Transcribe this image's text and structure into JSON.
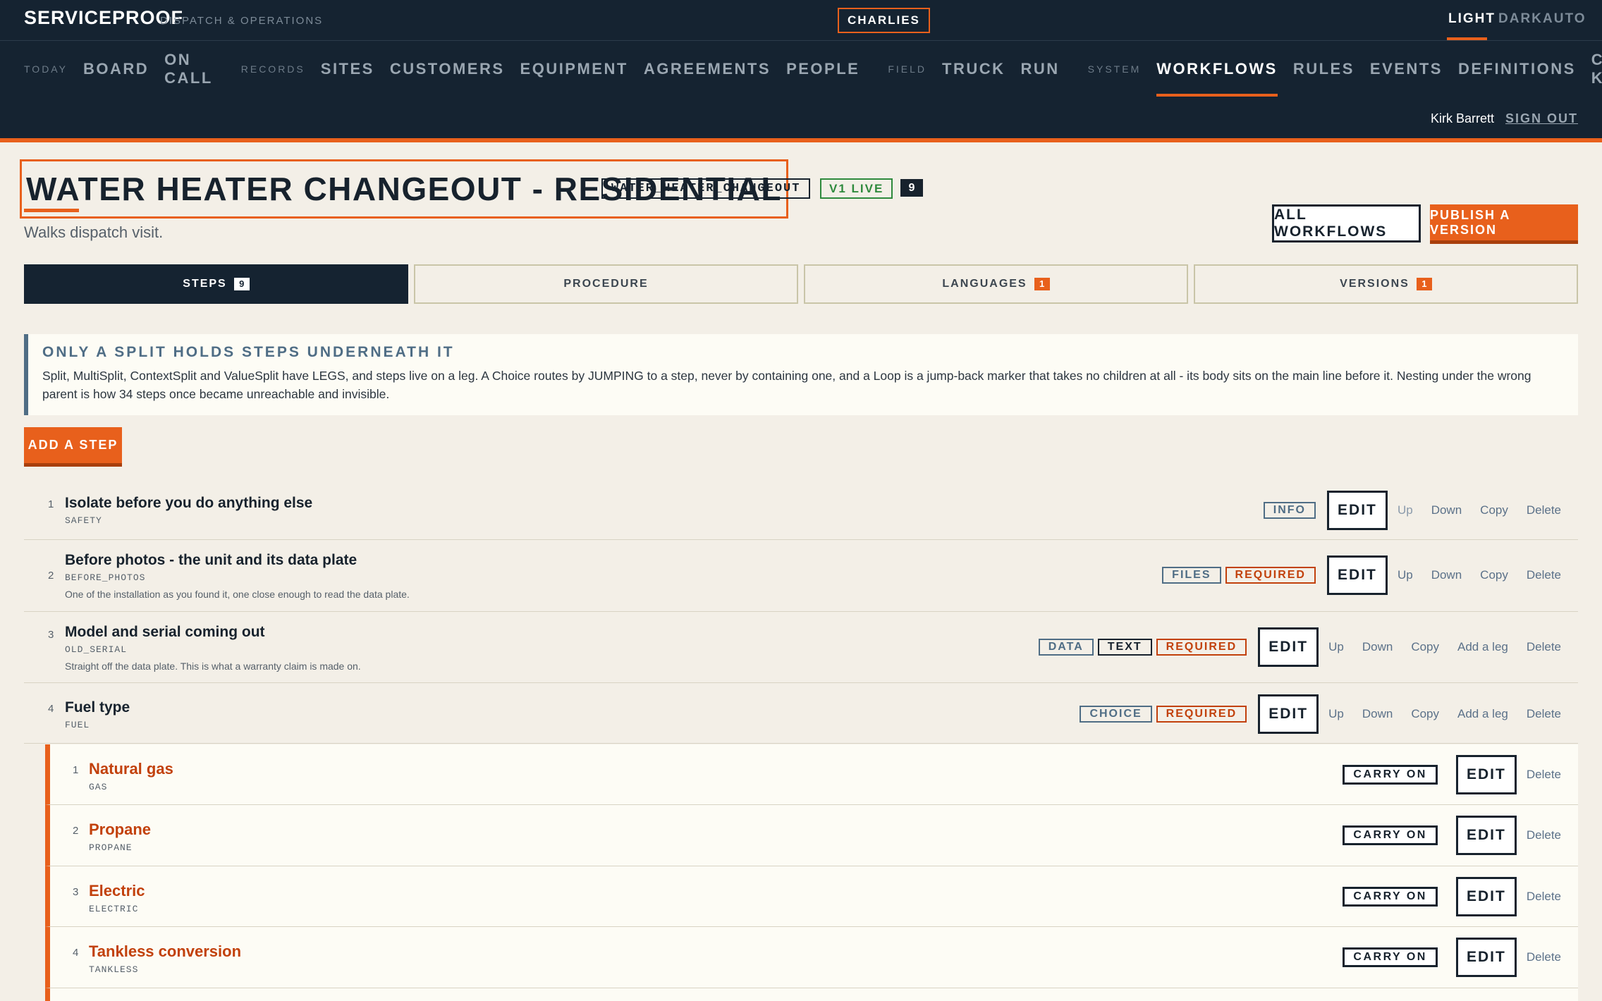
{
  "app": {
    "brand": "SERVICEPROOF",
    "brand_sub": "DISPATCH & OPERATIONS",
    "org": "CHARLIES"
  },
  "theme": {
    "light": "LIGHT",
    "dark": "DARK",
    "auto": "AUTO",
    "active": "LIGHT"
  },
  "nav": {
    "sec_today": "TODAY",
    "board": "BOARD",
    "on_call": "ON CALL",
    "sec_records": "RECORDS",
    "sites": "SITES",
    "customers": "CUSTOMERS",
    "equipment": "EQUIPMENT",
    "agreements": "AGREEMENTS",
    "people": "PEOPLE",
    "sec_field": "FIELD",
    "truck": "TRUCK",
    "run": "RUN",
    "sec_system": "SYSTEM",
    "workflows": "WORKFLOWS",
    "rules": "RULES",
    "events": "EVENTS",
    "definitions": "DEFINITIONS",
    "control_kit": "CONTROL KIT",
    "active": "WORKFLOWS"
  },
  "user": {
    "name": "Kirk Barrett",
    "sign_out": "SIGN OUT"
  },
  "header": {
    "title": "WATER HEATER CHANGEOUT - RESIDENTIAL",
    "key": "WATER_HEATER_CHANGEOUT",
    "live": "V1 LIVE",
    "count": "9",
    "subtitle": "Walks dispatch visit.",
    "all_workflows": "ALL WORKFLOWS",
    "publish": "PUBLISH A VERSION"
  },
  "tabs": [
    {
      "label": "STEPS",
      "badge": "9",
      "active": true
    },
    {
      "label": "PROCEDURE",
      "badge": ""
    },
    {
      "label": "LANGUAGES",
      "badge": "1"
    },
    {
      "label": "VERSIONS",
      "badge": "1"
    }
  ],
  "notice": {
    "heading": "ONLY A SPLIT HOLDS STEPS UNDERNEATH IT",
    "body": "Split, MultiSplit, ContextSplit and ValueSplit have LEGS, and steps live on a leg. A Choice routes by JUMPING to a step, never by containing one, and a Loop is a jump-back marker that takes no children at all - its body sits on the main line before it. Nesting under the wrong parent is how 34 steps once became unreachable and invisible."
  },
  "add_step": "ADD A STEP",
  "actions": {
    "edit": "EDIT",
    "up": "Up",
    "down": "Down",
    "copy": "Copy",
    "add_leg": "Add a leg",
    "delete": "Delete",
    "carry_on": "CARRY ON"
  },
  "steps": [
    {
      "num": "1",
      "title": "Isolate before you do anything else",
      "key": "SAFETY",
      "desc": "",
      "tags": [
        "INFO"
      ]
    },
    {
      "num": "2",
      "title": "Before photos - the unit and its data plate",
      "key": "BEFORE_PHOTOS",
      "desc": "One of the installation as you found it, one close enough to read the data plate.",
      "tags": [
        "FILES",
        "REQUIRED"
      ]
    },
    {
      "num": "3",
      "title": "Model and serial coming out",
      "key": "OLD_SERIAL",
      "desc": "Straight off the data plate. This is what a warranty claim is made on.",
      "tags": [
        "DATA",
        "TEXT",
        "REQUIRED"
      ]
    },
    {
      "num": "4",
      "title": "Fuel type",
      "key": "FUEL",
      "desc": "",
      "tags": [
        "CHOICE",
        "REQUIRED"
      ]
    }
  ],
  "legs": [
    {
      "num": "1",
      "title": "Natural gas",
      "key": "GAS"
    },
    {
      "num": "2",
      "title": "Propane",
      "key": "PROPANE"
    },
    {
      "num": "3",
      "title": "Electric",
      "key": "ELECTRIC"
    },
    {
      "num": "4",
      "title": "Tankless conversion",
      "key": "TANKLESS"
    }
  ],
  "colors": {
    "navy": "#152331",
    "accent": "#e8601c",
    "paper": "#f3efe7",
    "info": "#4f6d85",
    "required": "#c2410c",
    "live": "#2f8a3d"
  }
}
